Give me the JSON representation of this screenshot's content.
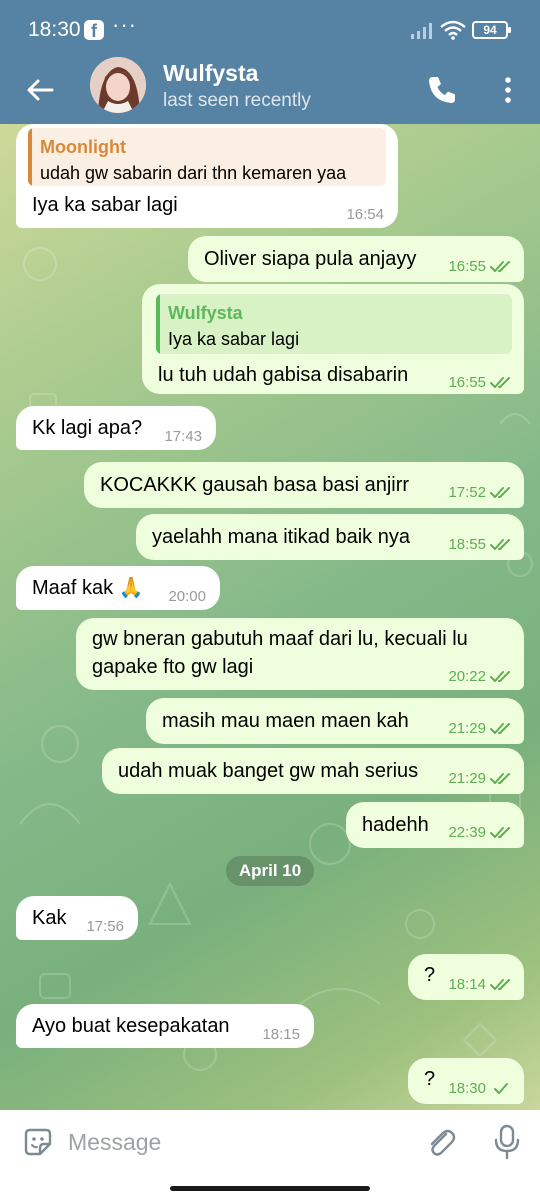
{
  "status_bar": {
    "time": "18:30",
    "fb_label": "f",
    "more": "···",
    "battery": "94"
  },
  "header": {
    "contact_name": "Wulfysta",
    "contact_status": "last seen recently",
    "icons": [
      "back-arrow-icon",
      "phone-icon",
      "more-vertical-icon"
    ]
  },
  "messages": [
    {
      "dir": "in",
      "reply": {
        "name": "Moonlight",
        "text": "udah gw sabarin dari thn kemaren yaa",
        "color": "#d9893a"
      },
      "text": "Iya ka sabar lagi",
      "time": "16:54"
    },
    {
      "dir": "out",
      "text": "Oliver siapa pula anjayy",
      "time": "16:55",
      "read": true
    },
    {
      "dir": "out",
      "reply": {
        "name": "Wulfysta",
        "text": "Iya ka sabar lagi",
        "color": "#5cb85c"
      },
      "text": "lu tuh udah gabisa disabarin",
      "time": "16:55",
      "read": true
    },
    {
      "dir": "in",
      "text": "Kk lagi apa?",
      "time": "17:43"
    },
    {
      "dir": "out",
      "text": "KOCAKKK gausah basa basi anjirr",
      "time": "17:52",
      "read": true
    },
    {
      "dir": "out",
      "text": "yaelahh mana itikad baik nya",
      "time": "18:55",
      "read": true
    },
    {
      "dir": "in",
      "text": "Maaf kak 🙏",
      "time": "20:00"
    },
    {
      "dir": "out",
      "text": "gw bneran gabutuh maaf dari lu, kecuali lu",
      "text2": "gapake fto gw lagi",
      "time": "20:22",
      "read": true
    },
    {
      "dir": "out",
      "text": "masih mau maen maen kah",
      "time": "21:29",
      "read": true
    },
    {
      "dir": "out",
      "text": "udah muak banget gw mah serius",
      "time": "21:29",
      "read": true
    },
    {
      "dir": "out",
      "text": "hadehh",
      "time": "22:39",
      "read": true
    },
    {
      "dir": "in",
      "text": "Kak",
      "time": "17:56"
    },
    {
      "dir": "out",
      "text": "?",
      "time": "18:14",
      "read": true
    },
    {
      "dir": "in",
      "text": "Ayo buat kesepakatan",
      "time": "18:15"
    },
    {
      "dir": "out",
      "text": "?",
      "time": "18:30",
      "read": false
    }
  ],
  "date_separator": "April 10",
  "input": {
    "placeholder": "Message",
    "value": ""
  },
  "colors": {
    "header": "#5682a3",
    "bubble_in": "#ffffff",
    "bubble_out": "#effedd",
    "meta_out": "#5fae52"
  }
}
